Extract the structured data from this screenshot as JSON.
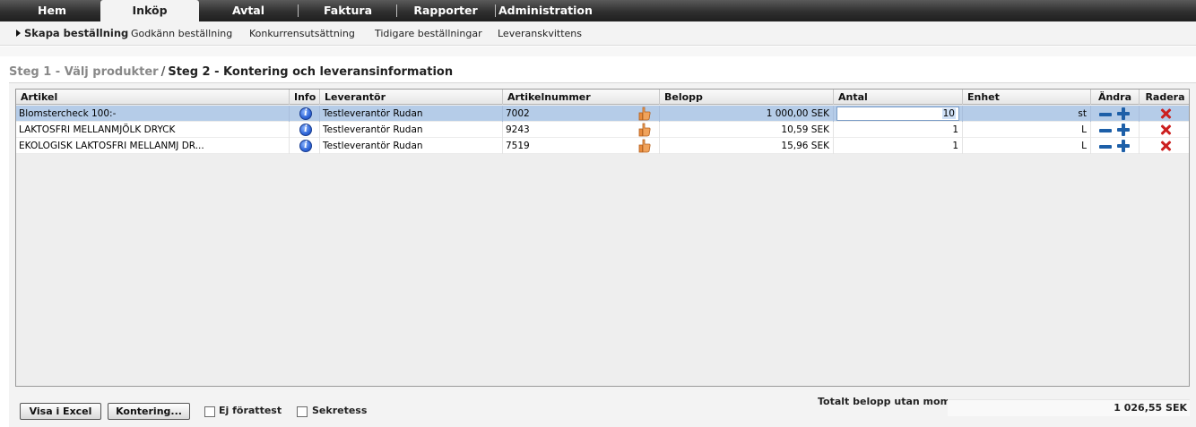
{
  "nav": {
    "tabs": [
      {
        "label": "Hem"
      },
      {
        "label": "Inköp"
      },
      {
        "label": "Avtal"
      },
      {
        "label": "Faktura"
      },
      {
        "label": "Rapporter"
      },
      {
        "label": "Administration"
      }
    ],
    "active_tab": "Inköp"
  },
  "subnav": {
    "items": [
      {
        "label": "Skapa beställning"
      },
      {
        "label": "Godkänn beställning"
      },
      {
        "label": "Konkurrensutsättning"
      },
      {
        "label": "Tidigare beställningar"
      },
      {
        "label": "Leveranskvittens"
      }
    ],
    "active_item": "Skapa beställning"
  },
  "breadcrumb": {
    "step1": "Steg 1 - Välj produkter",
    "separator": "/",
    "step2": "Steg 2 - Kontering och leveransinformation"
  },
  "table": {
    "columns": {
      "artikel": "Artikel",
      "info": "Info",
      "leverantor": "Leverantör",
      "artikelnummer": "Artikelnummer",
      "belopp": "Belopp",
      "antal": "Antal",
      "enhet": "Enhet",
      "andra": "Ändra",
      "radera": "Radera"
    },
    "rows": [
      {
        "artikel": "Blomstercheck 100:-",
        "leverantor": "Testleverantör Rudan",
        "artikelnummer": "7002",
        "belopp": "1 000,00 SEK",
        "antal": "10",
        "enhet": "st",
        "selected": true
      },
      {
        "artikel": "LAKTOSFRI MELLANMJÖLK DRYCK",
        "leverantor": "Testleverantör Rudan",
        "artikelnummer": "9243",
        "belopp": "10,59 SEK",
        "antal": "1",
        "enhet": "L",
        "selected": false
      },
      {
        "artikel": "EKOLOGISK LAKTOSFRI MELLANMJ DR...",
        "leverantor": "Testleverantör Rudan",
        "artikelnummer": "7519",
        "belopp": "15,96 SEK",
        "antal": "1",
        "enhet": "L",
        "selected": false
      }
    ]
  },
  "footer": {
    "visa_excel_label": "Visa i Excel",
    "kontering_label": "Kontering...",
    "ej_forattest_label": "Ej förattest",
    "ej_forattest_checked": false,
    "sekretess_label": "Sekretess",
    "sekretess_checked": false,
    "total_label": "Totalt belopp utan moms",
    "total_value": "1 026,55 SEK"
  },
  "colors": {
    "nav_bg": "#2f2f2f",
    "selected_row": "#b5cce8",
    "icon_blue": "#1d5fa8",
    "delete_red": "#cc1f1f"
  }
}
